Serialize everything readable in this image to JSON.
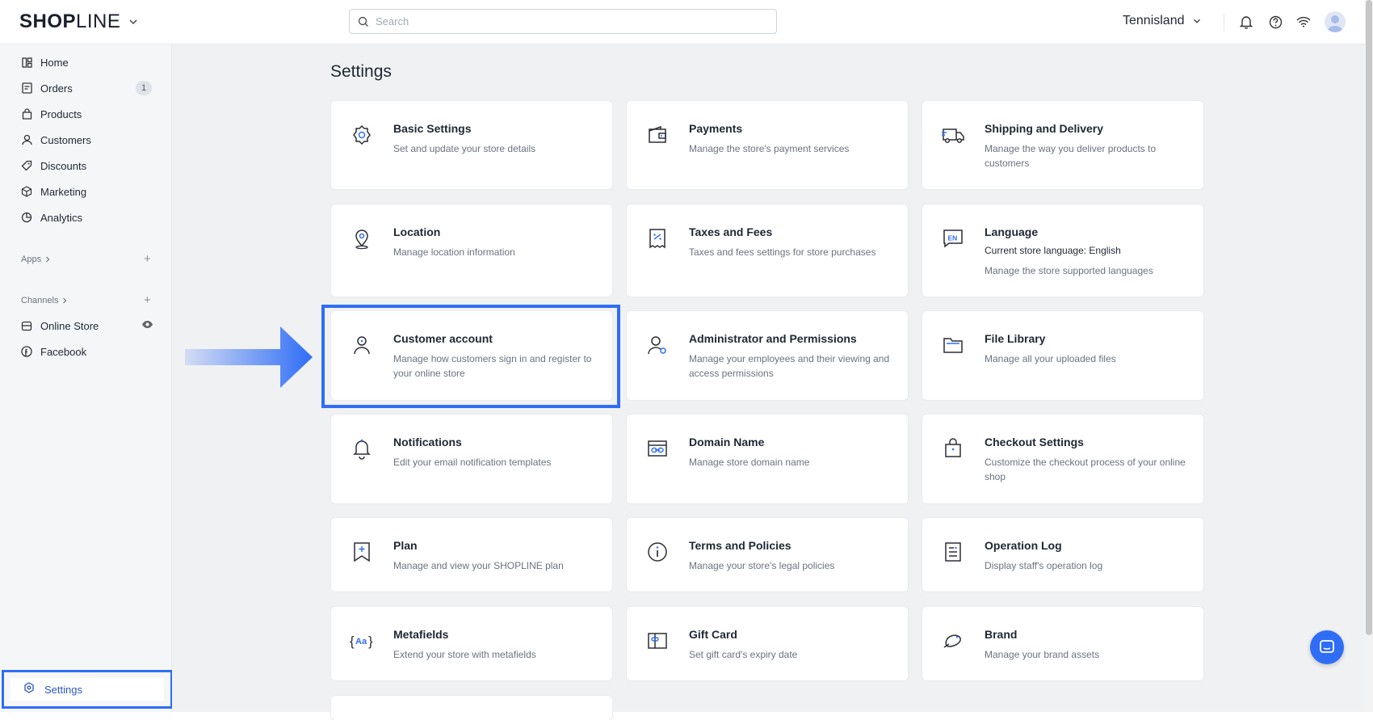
{
  "brand": {
    "logo_bold": "SHOP",
    "logo_light": "LINE"
  },
  "search": {
    "placeholder": "Search"
  },
  "store": {
    "name": "Tennisland"
  },
  "sidebar": {
    "items": [
      {
        "label": "Home",
        "icon": "dashboard-icon"
      },
      {
        "label": "Orders",
        "icon": "orders-icon",
        "badge": "1"
      },
      {
        "label": "Products",
        "icon": "bag-icon"
      },
      {
        "label": "Customers",
        "icon": "user-icon"
      },
      {
        "label": "Discounts",
        "icon": "tag-icon"
      },
      {
        "label": "Marketing",
        "icon": "cube-icon"
      },
      {
        "label": "Analytics",
        "icon": "pie-chart-icon"
      }
    ],
    "apps_label": "Apps",
    "channels_label": "Channels",
    "channels": [
      {
        "label": "Online Store",
        "icon": "store-icon"
      },
      {
        "label": "Facebook",
        "icon": "facebook-icon"
      }
    ],
    "settings_label": "Settings"
  },
  "main": {
    "title": "Settings",
    "cards": [
      {
        "title": "Basic Settings",
        "desc": "Set and update your store details",
        "icon": "gear-icon"
      },
      {
        "title": "Payments",
        "desc": "Manage the store's payment services",
        "icon": "wallet-icon"
      },
      {
        "title": "Shipping and Delivery",
        "desc": "Manage the way you deliver products to customers",
        "icon": "truck-icon"
      },
      {
        "title": "Location",
        "desc": "Manage location information",
        "icon": "location-pin-icon"
      },
      {
        "title": "Taxes and Fees",
        "desc": "Taxes and fees settings for store purchases",
        "icon": "receipt-icon"
      },
      {
        "title": "Language",
        "extra": "Current store language: English",
        "desc": "Manage the store supported languages",
        "icon": "language-icon"
      },
      {
        "title": "Customer account",
        "desc": "Manage how customers sign in and register to your online store",
        "icon": "user-icon"
      },
      {
        "title": "Administrator and Permissions",
        "desc": "Manage your employees and their viewing and access permissions",
        "icon": "user-gear-icon"
      },
      {
        "title": "File Library",
        "desc": "Manage all your uploaded files",
        "icon": "folder-icon"
      },
      {
        "title": "Notifications",
        "desc": "Edit your email notification templates",
        "icon": "bell-icon"
      },
      {
        "title": "Domain Name",
        "desc": "Manage store domain name",
        "icon": "domain-link-icon"
      },
      {
        "title": "Checkout Settings",
        "desc": "Customize the checkout process of your online shop",
        "icon": "shopping-bag-icon"
      },
      {
        "title": "Plan",
        "desc": "Manage and view your SHOPLINE plan",
        "icon": "plan-bookmark-icon"
      },
      {
        "title": "Terms and Policies",
        "desc": "Manage your store's legal policies",
        "icon": "info-icon"
      },
      {
        "title": "Operation Log",
        "desc": "Display staff's operation log",
        "icon": "log-icon"
      },
      {
        "title": "Metafields",
        "desc": "Extend your store with metafields",
        "icon": "metafields-icon"
      },
      {
        "title": "Gift Card",
        "desc": "Set gift card's expiry date",
        "icon": "gift-card-icon"
      },
      {
        "title": "Brand",
        "desc": "Manage your brand assets",
        "icon": "brand-icon"
      }
    ]
  },
  "colors": {
    "accent": "#2f6df6",
    "background": "#f0f1f3",
    "sidebar": "#f5f6f8"
  }
}
